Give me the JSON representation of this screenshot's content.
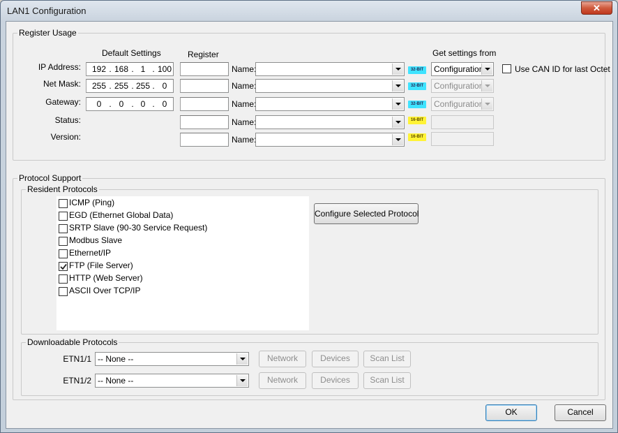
{
  "window": {
    "title": "LAN1 Configuration",
    "close_glyph": "✕"
  },
  "register_usage": {
    "label": "Register Usage",
    "col_default": "Default Settings",
    "col_register": "Register",
    "col_get_from": "Get settings from",
    "name_label": "Name:",
    "rows": [
      {
        "label": "IP Address:",
        "ip": [
          "192",
          "168",
          "1",
          "100"
        ],
        "badge": "32-BIT",
        "get_from": "Configuration"
      },
      {
        "label": "Net Mask:",
        "ip": [
          "255",
          "255",
          "255",
          "0"
        ],
        "badge": "32-BIT",
        "get_from": "Configuration"
      },
      {
        "label": "Gateway:",
        "ip": [
          "0",
          "0",
          "0",
          "0"
        ],
        "badge": "32-BIT",
        "get_from": "Configuration"
      },
      {
        "label": "Status:",
        "badge": "16-BIT",
        "get_from": ""
      },
      {
        "label": "Version:",
        "badge": "16-BIT",
        "get_from": ""
      }
    ],
    "use_can_id": {
      "label": "Use CAN ID for last Octet",
      "checked": false
    }
  },
  "protocol_support": {
    "label": "Protocol Support",
    "resident_label": "Resident Protocols",
    "configure_button": "Configure Selected Protocol",
    "protocols": [
      {
        "label": "ICMP (Ping)",
        "checked": false
      },
      {
        "label": "EGD (Ethernet Global Data)",
        "checked": false
      },
      {
        "label": "SRTP Slave (90-30 Service Request)",
        "checked": false
      },
      {
        "label": "Modbus Slave",
        "checked": false
      },
      {
        "label": "Ethernet/IP",
        "checked": false
      },
      {
        "label": "FTP (File Server)",
        "checked": true
      },
      {
        "label": "HTTP (Web Server)",
        "checked": false
      },
      {
        "label": "ASCII Over TCP/IP",
        "checked": false
      }
    ],
    "downloadable_label": "Downloadable Protocols",
    "downloadable": [
      {
        "label": "ETN1/1",
        "value": "-- None --"
      },
      {
        "label": "ETN1/2",
        "value": "-- None --"
      }
    ],
    "buttons": {
      "network": "Network",
      "devices": "Devices",
      "scan_list": "Scan List"
    }
  },
  "footer": {
    "ok": "OK",
    "cancel": "Cancel"
  }
}
